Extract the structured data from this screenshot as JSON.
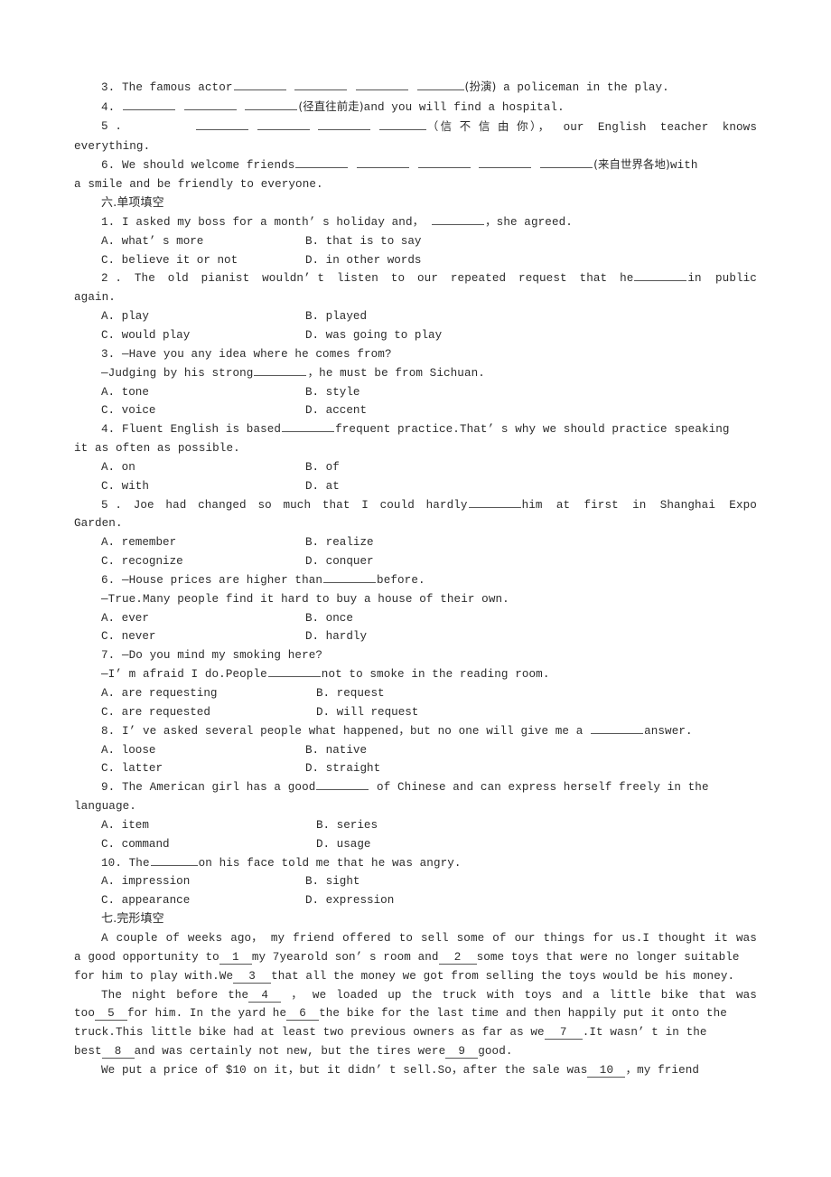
{
  "document": {
    "language": "English exercise worksheet (Chinese textbook)",
    "translation_section": {
      "items": [
        {
          "number": "3.",
          "before": "The famous actor",
          "blanks": 4,
          "hint": "(扮演)",
          "after": " a policeman in the play."
        },
        {
          "number": "4.",
          "before": "",
          "blanks": 3,
          "hint": "(径直往前走)",
          "after": "and you will find a hospital."
        },
        {
          "number": "5 .",
          "before": "",
          "blanks": 4,
          "hint": "（信 不 信 由 你）",
          "after": "，  our  English  teacher  knows",
          "wrap": "everything."
        },
        {
          "number": "6.",
          "before": "We should welcome friends",
          "blanks": 5,
          "hint": "(来自世界各地)",
          "after": "with",
          "wrap": "a smile and be friendly to everyone."
        }
      ]
    },
    "section_six": {
      "heading": "六.单项填空",
      "questions": [
        {
          "number": "1.",
          "stem_parts": [
            "I asked my boss for a month’ s holiday and，",
            "，she agreed."
          ],
          "options": [
            "A. what’ s more",
            "B. that is to say",
            "C. believe it or not",
            "D. in other words"
          ]
        },
        {
          "number": "2 .",
          "stem_justified": [
            "2 .",
            "The",
            "old",
            "pianist",
            "wouldn’ t",
            "listen",
            "to",
            "our",
            "repeated",
            "request",
            "that",
            "he"
          ],
          "stem_tail": "in  public",
          "stem_wrap": "again.",
          "options": [
            "A. play",
            "B. played",
            "C. would play",
            "D. was going to play"
          ]
        },
        {
          "number": "3.",
          "stem_line1": "3. —Have you any idea where he comes from?",
          "stem_line2a": "—Judging by his strong",
          "stem_line2b": "，he must be from Sichuan.",
          "options": [
            "A. tone",
            "B. style",
            "C. voice",
            "D. accent"
          ]
        },
        {
          "number": "4.",
          "stem_a": "4. Fluent English is based",
          "stem_b": "frequent practice.That’ s why we should practice speaking",
          "stem_wrap": "it as often as possible.",
          "options": [
            "A. on",
            "B. of",
            "C. with",
            "D. at"
          ]
        },
        {
          "number": "5 .",
          "stem_justified": [
            "5 .",
            "Joe",
            "had",
            "changed",
            "so",
            "much",
            "that",
            "I",
            "could",
            "hardly"
          ],
          "stem_tail": "him  at  first  in  Shanghai  Expo",
          "stem_wrap": "Garden.",
          "options": [
            "A. remember",
            "B. realize",
            "C. recognize",
            "D. conquer"
          ]
        },
        {
          "number": "6.",
          "stem_line1a": "6. —House prices are higher than",
          "stem_line1b": "before.",
          "stem_line2": "—True.Many people find it hard to buy a house of their own.",
          "options": [
            "A. ever",
            "B. once",
            "C. never",
            "D. hardly"
          ]
        },
        {
          "number": "7.",
          "stem_line1": "7. —Do you mind my smoking here?",
          "stem_line2a": "—I’ m afraid I do.People",
          "stem_line2b": "not to smoke in the reading room.",
          "options": [
            "A. are requesting",
            "B. request",
            "C. are requested",
            "D. will request"
          ]
        },
        {
          "number": "8.",
          "stem_a": "8. I’ ve asked several people what happened，but no one will give me a ",
          "stem_b": "answer.",
          "options": [
            "A. loose",
            "B. native",
            "C. latter",
            "D. straight"
          ]
        },
        {
          "number": "9.",
          "stem_a": "9. The American girl has a good",
          "stem_b": " of Chinese and can express herself freely in the",
          "stem_wrap": "language.",
          "options": [
            "A. item",
            "B. series",
            "C. command",
            "D. usage"
          ]
        },
        {
          "number": "10.",
          "stem_a": "10. The",
          "stem_b": "on his face told me that he was angry.",
          "options": [
            "A. impression",
            "B. sight",
            "C. appearance",
            "D. expression"
          ]
        }
      ]
    },
    "section_seven": {
      "heading": "七.完形填空",
      "paragraph1": {
        "line1_justified": [
          "A",
          "couple",
          "of",
          "weeks",
          "ago，",
          "my",
          "friend",
          "offered",
          "to",
          "sell",
          "some",
          "of",
          "our",
          "things",
          "for",
          "us.I",
          "thought",
          "it",
          "was"
        ],
        "line2_a": "a good opportunity to",
        "line2_blank1": "1",
        "line2_b": "my 7yearold son’ s room and",
        "line2_blank2": "2",
        "line2_c": "some toys that were no longer suitable",
        "line3_a": "for him to play with.We",
        "line3_blank": "3",
        "line3_b": "that all the money we got from selling the toys would be his money."
      },
      "paragraph2": {
        "line1_justified": [
          "The",
          "night",
          "before",
          "the"
        ],
        "line1_blank": "4",
        "line1_tail": [
          "，",
          "we",
          "loaded",
          "up",
          "the",
          "truck",
          "with",
          "toys",
          "and",
          "a",
          "little",
          "bike",
          "that",
          "was"
        ],
        "line2_a": "too",
        "line2_blank1": "5",
        "line2_b": "for him. In the yard he",
        "line2_blank2": "6",
        "line2_c": "the bike for the last time and then happily put it onto the",
        "line3_a": "truck.This little bike had at least two previous owners as far as we",
        "line3_blank": "7",
        "line3_b": ".It wasn’ t in the",
        "line4_a": "best",
        "line4_blank1": "8",
        "line4_b": "and was certainly not new, but the tires were",
        "line4_blank2": "9",
        "line4_c": "good."
      },
      "paragraph3": {
        "line1_a": "We put a price of $10 on it，but it didn’ t sell.So，after the sale was",
        "line1_blank": "10",
        "line1_b": "，my friend"
      }
    }
  }
}
